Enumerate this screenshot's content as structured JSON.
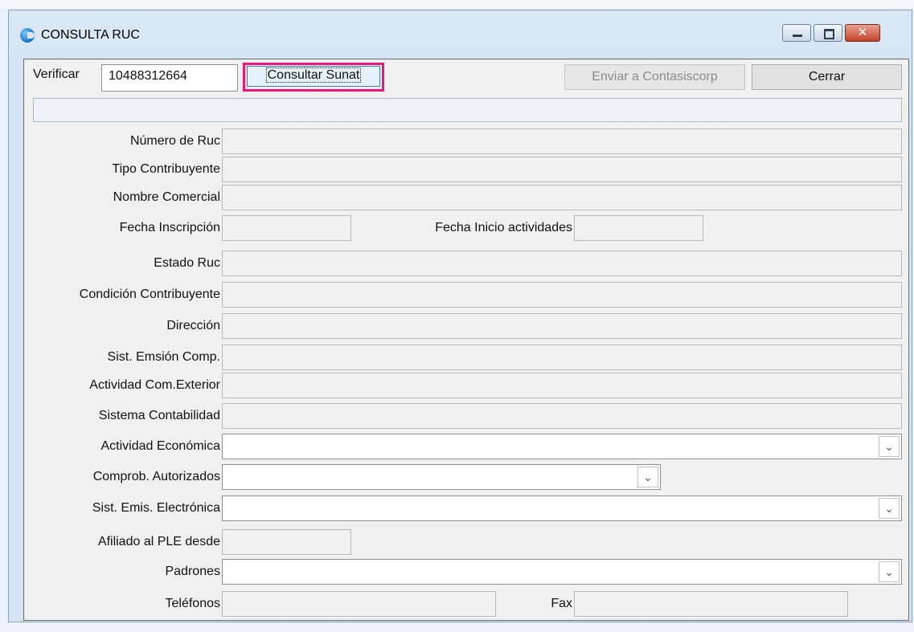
{
  "window": {
    "title": "CONSULTA RUC",
    "icon": "app-circle-icon"
  },
  "controls": {
    "minimize": "minimize-icon",
    "maximize": "maximize-icon",
    "close": "✕"
  },
  "toolbar": {
    "verificar_label": "Verificar",
    "ruc_value": "10488312664",
    "consultar_label": "Consultar Sunat",
    "enviar_label": "Enviar a Contasiscorp",
    "cerrar_label": "Cerrar"
  },
  "status_bar_value": "",
  "fields": {
    "numero_ruc": "Número de Ruc",
    "tipo_contribuyente": "Tipo Contribuyente",
    "nombre_comercial": "Nombre Comercial",
    "fecha_inscripcion": "Fecha Inscripción",
    "fecha_inicio": "Fecha Inicio actividades",
    "estado_ruc": "Estado Ruc",
    "condicion": "Condición Contribuyente",
    "direccion": "Dirección",
    "sist_emision": "Sist. Emsión Comp.",
    "actividad_com_exterior": "Actividad Com.Exterior",
    "sistema_contabilidad": "Sistema Contabilidad",
    "actividad_economica": "Actividad Económica",
    "comprob_autorizados": "Comprob. Autorizados",
    "sist_emis_electronica": "Sist. Emis. Electrónica",
    "afiliado_ple": "Afiliado al PLE desde",
    "padrones": "Padrones",
    "telefonos": "Teléfonos",
    "fax": "Fax"
  },
  "colors": {
    "highlight": "#e8177d",
    "close_button": "#c2432c",
    "title_bar": "#d9e6f4"
  }
}
